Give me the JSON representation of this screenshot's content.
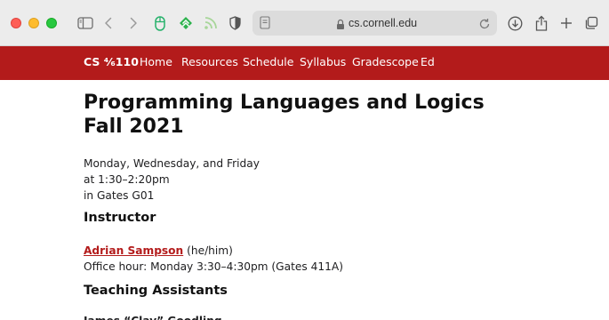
{
  "browser": {
    "url": "cs.cornell.edu",
    "colors": {
      "chrome_bg": "#ececec",
      "urlbar_bg": "#dcdcdc"
    },
    "toolbar_icons": [
      "sidebar-icon",
      "back-icon",
      "forward-icon",
      "extension-mouse-icon",
      "extension-feedly-icon",
      "rss-icon",
      "shield-icon",
      "page-icon",
      "lock-icon",
      "reload-icon",
      "download-icon",
      "share-icon",
      "new-tab-icon",
      "tab-overview-icon"
    ]
  },
  "nav": {
    "brand": "CS ⁴⁄₆110",
    "items": [
      "Home",
      "Resources",
      "Schedule",
      "Syllabus",
      "Gradescope",
      "Ed"
    ],
    "color": "#b31b1b"
  },
  "page": {
    "title_line1": "Programming Languages and Logics",
    "title_line2": "Fall 2021",
    "schedule": {
      "days": "Monday, Wednesday, and Friday",
      "time": "at 1:30–2:20pm",
      "place": "in Gates G01"
    },
    "instructor_heading": "Instructor",
    "instructor": {
      "name": "Adrian Sampson",
      "pronouns": " (he/him)",
      "office_hour": "Office hour: Monday 3:30–4:30pm (Gates 411A)"
    },
    "ta_heading": "Teaching Assistants",
    "ta_first": "James “Clay” Goodling"
  }
}
